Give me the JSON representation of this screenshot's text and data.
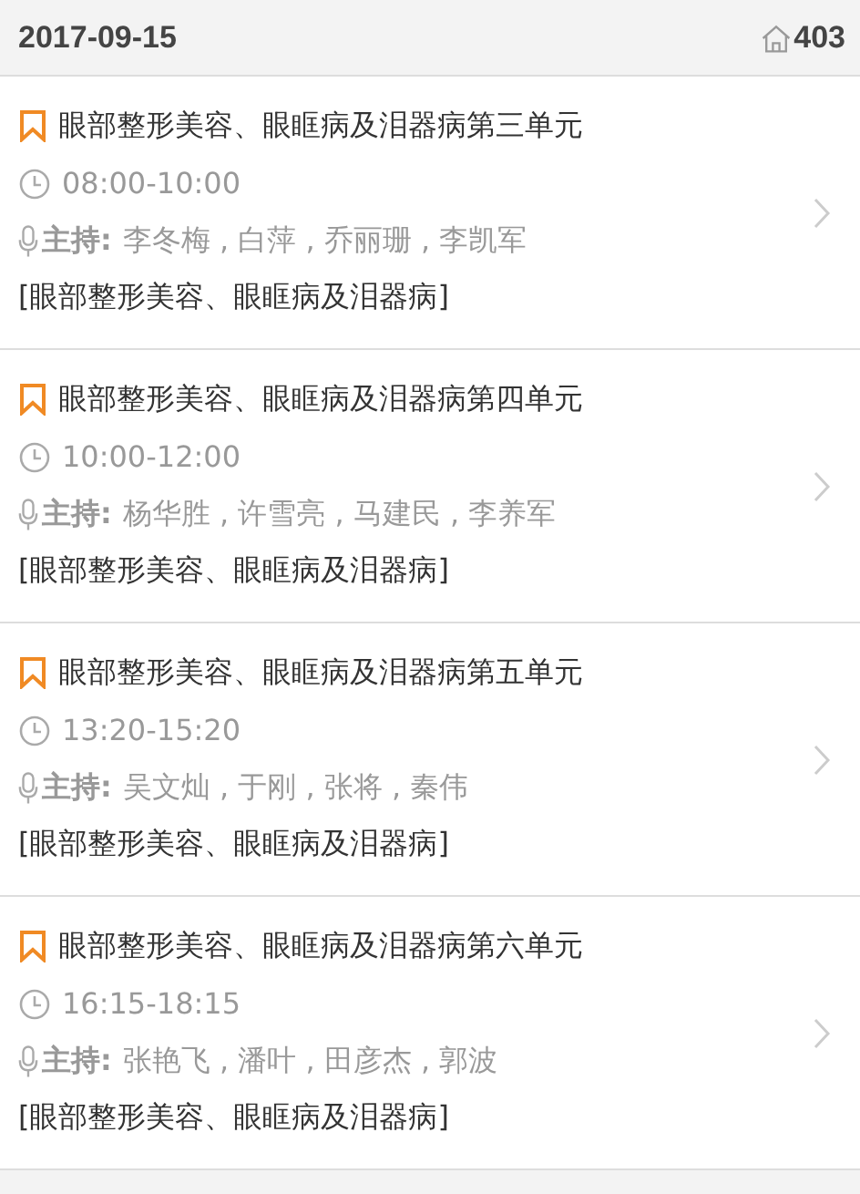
{
  "header": {
    "date": "2017-09-15",
    "room": "403"
  },
  "sessions": [
    {
      "title": "眼部整形美容、眼眶病及泪器病第三单元",
      "time": "08:00-10:00",
      "host_label": "主持:",
      "hosts": "李冬梅 , 白萍 , 乔丽珊 , 李凯军",
      "track": "[眼部整形美容、眼眶病及泪器病]"
    },
    {
      "title": "眼部整形美容、眼眶病及泪器病第四单元",
      "time": "10:00-12:00",
      "host_label": "主持:",
      "hosts": "杨华胜 , 许雪亮 , 马建民 , 李养军",
      "track": "[眼部整形美容、眼眶病及泪器病]"
    },
    {
      "title": "眼部整形美容、眼眶病及泪器病第五单元",
      "time": "13:20-15:20",
      "host_label": "主持:",
      "hosts": "吴文灿 , 于刚 , 张将 , 秦伟",
      "track": "[眼部整形美容、眼眶病及泪器病]"
    },
    {
      "title": "眼部整形美容、眼眶病及泪器病第六单元",
      "time": "16:15-18:15",
      "host_label": "主持:",
      "hosts": "张艳飞 , 潘叶 , 田彦杰 , 郭波",
      "track": "[眼部整形美容、眼眶病及泪器病]"
    }
  ]
}
